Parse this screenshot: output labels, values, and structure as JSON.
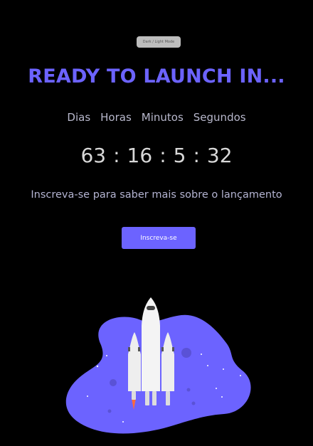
{
  "mode_toggle": {
    "label": "Dark / Light Mode"
  },
  "title": "READY TO LAUNCH IN...",
  "units": {
    "days": "Dias",
    "hours": "Horas",
    "minutes": "Minutos",
    "seconds": "Segundos"
  },
  "countdown": {
    "days": "63",
    "hours": "16",
    "minutes": "5",
    "seconds": "32",
    "separator": ":"
  },
  "subtitle": "Inscreva-se para saber mais sobre o lançamento",
  "cta": {
    "label": "Inscreva-se"
  },
  "colors": {
    "accent": "#6c63ff",
    "background": "#000000"
  },
  "illustration": {
    "icon": "rocket-launch-icon"
  }
}
